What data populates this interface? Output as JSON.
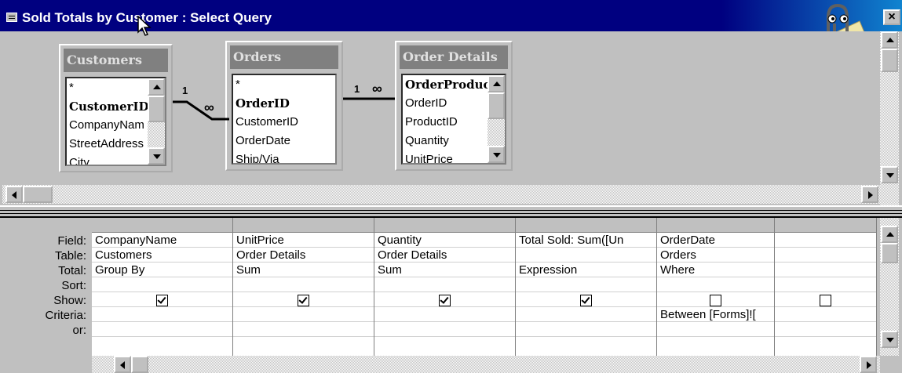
{
  "window": {
    "title": "Sold Totals by Customer : Select Query",
    "close_label": "×"
  },
  "tables": [
    {
      "name": "Customers",
      "fields": [
        "*",
        "CustomerID",
        "CompanyNam",
        "StreetAddress",
        "City"
      ],
      "key_field": "CustomerID"
    },
    {
      "name": "Orders",
      "fields": [
        "*",
        "OrderID",
        "CustomerID",
        "OrderDate",
        "Ship/Via"
      ],
      "key_field": "OrderID"
    },
    {
      "name": "Order Details",
      "fields": [
        "OrderProduct",
        "OrderID",
        "ProductID",
        "Quantity",
        "UnitPrice"
      ],
      "key_field": "OrderProduct"
    }
  ],
  "joins": [
    {
      "one": "1",
      "many": "∞"
    },
    {
      "one": "1",
      "many": "∞"
    }
  ],
  "grid": {
    "row_labels": [
      "Field:",
      "Table:",
      "Total:",
      "Sort:",
      "Show:",
      "Criteria:",
      "or:"
    ],
    "columns": [
      {
        "field": "CompanyName",
        "table": "Customers",
        "total": "Group By",
        "sort": "",
        "show": true,
        "criteria": "",
        "or": ""
      },
      {
        "field": "UnitPrice",
        "table": "Order Details",
        "total": "Sum",
        "sort": "",
        "show": true,
        "criteria": "",
        "or": ""
      },
      {
        "field": "Quantity",
        "table": "Order Details",
        "total": "Sum",
        "sort": "",
        "show": true,
        "criteria": "",
        "or": ""
      },
      {
        "field": "Total Sold: Sum([Un",
        "table": "",
        "total": "Expression",
        "sort": "",
        "show": true,
        "criteria": "",
        "or": ""
      },
      {
        "field": "OrderDate",
        "table": "Orders",
        "total": "Where",
        "sort": "",
        "show": false,
        "criteria": "Between [Forms]![",
        "or": ""
      },
      {
        "field": "",
        "table": "",
        "total": "",
        "sort": "",
        "show": false,
        "criteria": "",
        "or": ""
      }
    ]
  },
  "colors": {
    "titlebar": "#000080",
    "face": "#c0c0c0",
    "header_gray": "#808080"
  }
}
